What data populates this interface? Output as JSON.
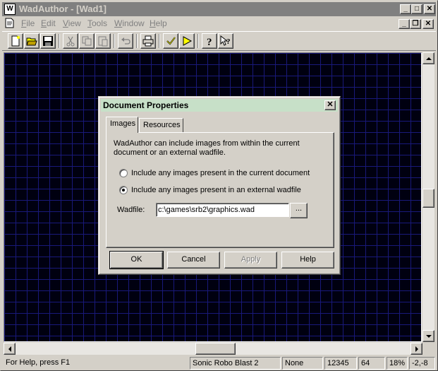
{
  "app": {
    "title": "WadAuthor - [Wad1]",
    "icon_glyph": "W"
  },
  "window_controls": {
    "minimize": "_",
    "maximize": "□",
    "close": "✕"
  },
  "menu": {
    "items": [
      {
        "label": "File",
        "accel": "F"
      },
      {
        "label": "Edit",
        "accel": "E"
      },
      {
        "label": "View",
        "accel": "V"
      },
      {
        "label": "Tools",
        "accel": "T"
      },
      {
        "label": "Window",
        "accel": "W"
      },
      {
        "label": "Help",
        "accel": "H"
      }
    ],
    "mdi_controls": {
      "minimize": "_",
      "restore": "❐",
      "close": "✕"
    }
  },
  "toolbar": {
    "buttons": [
      "new-icon",
      "open-icon",
      "save-icon",
      "cut-icon",
      "copy-icon",
      "paste-icon",
      "undo-icon",
      "print-icon",
      "check-icon",
      "run-icon",
      "help-icon",
      "context-help-icon"
    ]
  },
  "dialog": {
    "title": "Document Properties",
    "close_glyph": "✕",
    "tabs": [
      {
        "label": "Images",
        "active": true
      },
      {
        "label": "Resources",
        "active": false
      }
    ],
    "description_line1": "WadAuthor can include images from within the current",
    "description_line2": "document or an external wadfile.",
    "radio_current": "Include any images present in the current document",
    "radio_external": "Include any images present in an external wadfile",
    "radio_selected": "external",
    "wadfile_label": "Wadfile:",
    "wadfile_value": "c:\\games\\srb2\\graphics.wad",
    "browse_label": "...",
    "buttons": {
      "ok": "OK",
      "cancel": "Cancel",
      "apply": "Apply",
      "help": "Help"
    }
  },
  "status_bar": {
    "message": "For Help, press F1",
    "game": "Sonic Robo Blast 2",
    "mode": "None",
    "field1": "12345",
    "grid": "64",
    "zoom": "18%",
    "coords": "-2,-8"
  },
  "colors": {
    "map_background": "#000010",
    "grid_line": "#19197a",
    "dialog_title_bg": "#c7e0c8",
    "title_bar_inactive": "#808080",
    "face": "#d4d0c8"
  }
}
